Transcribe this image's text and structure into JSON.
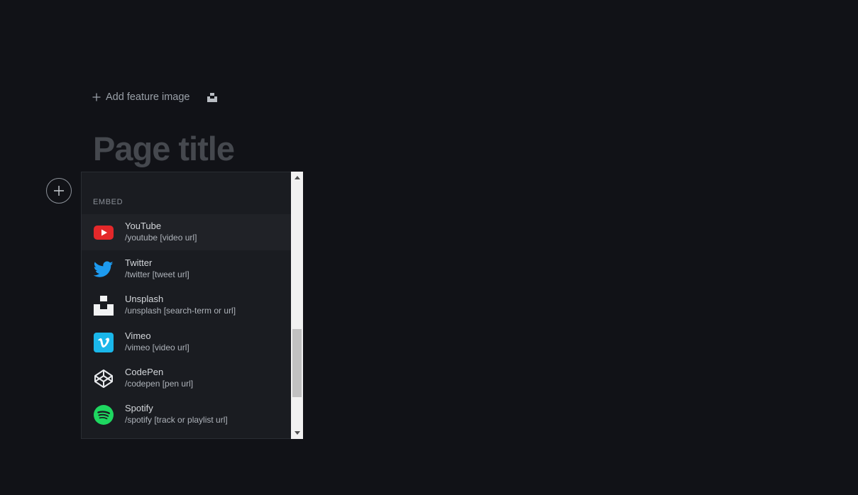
{
  "editor": {
    "add_feature_image": "Add feature image",
    "page_title_placeholder": "Page title"
  },
  "card_menu": {
    "section_label": "EMBED",
    "items": [
      {
        "name": "YouTube",
        "command": "/youtube [video url]",
        "icon": "youtube-icon"
      },
      {
        "name": "Twitter",
        "command": "/twitter [tweet url]",
        "icon": "twitter-icon"
      },
      {
        "name": "Unsplash",
        "command": "/unsplash [search-term or url]",
        "icon": "unsplash-icon"
      },
      {
        "name": "Vimeo",
        "command": "/vimeo [video url]",
        "icon": "vimeo-icon"
      },
      {
        "name": "CodePen",
        "command": "/codepen [pen url]",
        "icon": "codepen-icon"
      },
      {
        "name": "Spotify",
        "command": "/spotify [track or playlist url]",
        "icon": "spotify-icon"
      }
    ]
  },
  "colors": {
    "background": "#111217",
    "menu_background": "#1a1c21",
    "youtube": "#e4282a",
    "twitter": "#1d9bf0",
    "vimeo": "#1ab7ea",
    "spotify": "#1ed760"
  }
}
